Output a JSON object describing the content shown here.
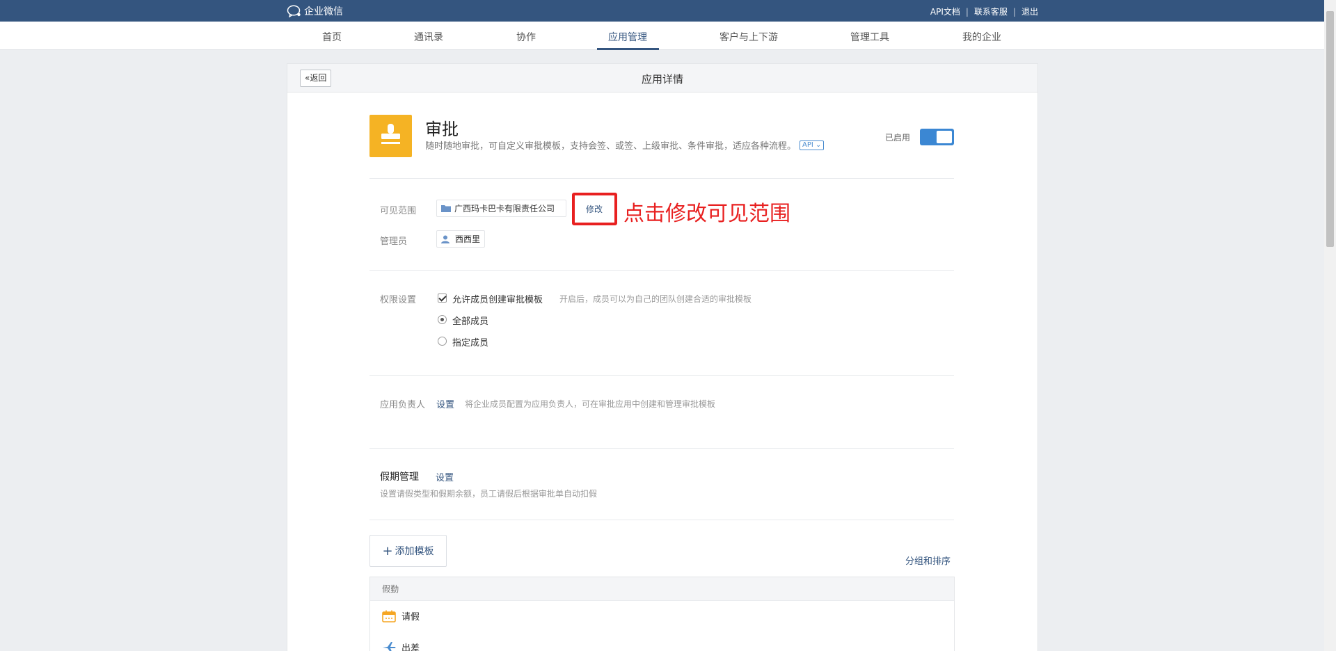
{
  "topbar": {
    "logo_text": "企业微信",
    "links": [
      "API文档",
      "联系客服",
      "退出"
    ]
  },
  "nav": {
    "items": [
      "首页",
      "通讯录",
      "协作",
      "应用管理",
      "客户与上下游",
      "管理工具",
      "我的企业"
    ],
    "active": "应用管理"
  },
  "panel": {
    "back_label": "返回",
    "title": "应用详情"
  },
  "app": {
    "name": "审批",
    "description": "随时随地审批，可自定义审批模板，支持会签、或签、上级审批、条件审批，适应各种流程。",
    "api_badge": "API",
    "status_label": "已启用",
    "enabled": true,
    "icon_color": "#f5b324"
  },
  "visibility": {
    "label": "可见范围",
    "scope": "广西玛卡巴卡有限责任公司",
    "modify_label": "修改"
  },
  "admin": {
    "label": "管理员",
    "name": "西西里"
  },
  "annotation": {
    "text": "点击修改可见范围",
    "color": "#e82020"
  },
  "permissions": {
    "label": "权限设置",
    "allow_create_label": "允许成员创建审批模板",
    "allow_create_hint": "开启后，成员可以为自己的团队创建合适的审批模板",
    "allow_create_checked": true,
    "options": [
      "全部成员",
      "指定成员"
    ],
    "selected_option": "全部成员"
  },
  "owner": {
    "label": "应用负责人",
    "set_label": "设置",
    "hint": "将企业成员配置为应用负责人，可在审批应用中创建和管理审批模板"
  },
  "holiday": {
    "title": "假期管理",
    "set_label": "设置",
    "hint": "设置请假类型和假期余额，员工请假后根据审批单自动扣假"
  },
  "templates": {
    "add_label": "添加模板",
    "sort_label": "分组和排序",
    "group_name": "假勤",
    "items": [
      "请假",
      "出差"
    ]
  },
  "colors": {
    "brand": "#34557f",
    "toggle": "#3b87d3"
  }
}
